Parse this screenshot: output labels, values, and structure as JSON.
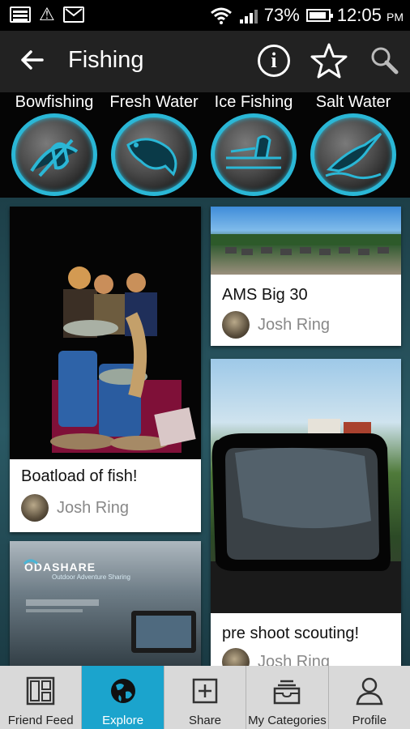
{
  "status_bar": {
    "battery": "73%",
    "time": "12:05",
    "ampm": "PM"
  },
  "header": {
    "title": "Fishing",
    "back_icon": "arrow-left-icon",
    "info_icon": "info-icon",
    "favorite_icon": "star-icon",
    "search_icon": "search-icon"
  },
  "categories": [
    {
      "label": "Bowfishing",
      "icon": "bowfishing-icon"
    },
    {
      "label": "Fresh Water",
      "icon": "bass-fish-icon"
    },
    {
      "label": "Ice Fishing",
      "icon": "ice-fishing-icon"
    },
    {
      "label": "Salt Water",
      "icon": "marlin-icon"
    }
  ],
  "feed": [
    {
      "caption": "Boatload of fish!",
      "author": "Josh Ring"
    },
    {
      "caption": "AMS Big 30",
      "author": "Josh Ring"
    },
    {
      "caption": "pre shoot scouting!",
      "author": "Josh Ring"
    },
    {
      "banner_brand": "ODASHARE",
      "banner_tagline": "Outdoor Adventure Sharing"
    }
  ],
  "nav": [
    {
      "label": "Friend Feed",
      "icon": "feed-grid-icon"
    },
    {
      "label": "Explore",
      "icon": "globe-icon",
      "active": true
    },
    {
      "label": "Share",
      "icon": "plus-square-icon"
    },
    {
      "label": "My Categories",
      "icon": "tray-stack-icon"
    },
    {
      "label": "Profile",
      "icon": "person-icon"
    }
  ],
  "colors": {
    "accent": "#1ba4cd",
    "ring": "#2ab7d6",
    "actionbar": "#222222"
  }
}
